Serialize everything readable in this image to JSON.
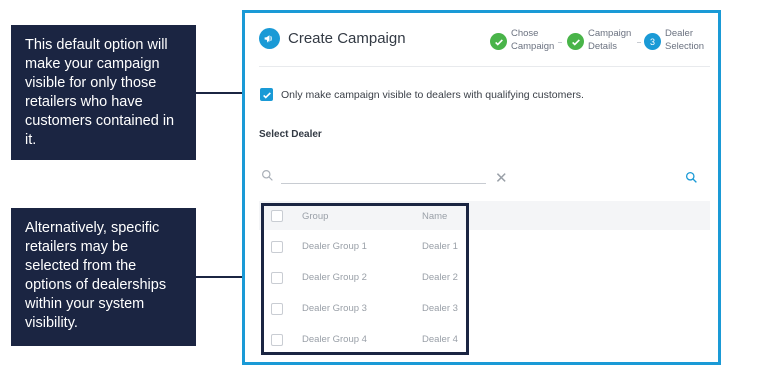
{
  "annotations": {
    "default_option": "This default option will make your campaign visible for only those retailers who have customers contained in it.",
    "specific_selection": "Alternatively, specific retailers may be selected from the options of dealerships within your system visibility."
  },
  "modal": {
    "title": "Create Campaign",
    "steps": [
      {
        "label_line1": "Chose",
        "label_line2": "Campaign",
        "state": "complete"
      },
      {
        "label_line1": "Campaign",
        "label_line2": "Details",
        "state": "complete"
      },
      {
        "number": "3",
        "label_line1": "Dealer",
        "label_line2": "Selection",
        "state": "active"
      }
    ],
    "visibility_option": {
      "checked": true,
      "label": "Only make campaign visible to dealers with qualifying customers."
    },
    "select_dealer_label": "Select Dealer",
    "search": {
      "value": ""
    },
    "table": {
      "headers": {
        "group": "Group",
        "name": "Name"
      },
      "rows": [
        {
          "group": "Dealer Group 1",
          "name": "Dealer 1"
        },
        {
          "group": "Dealer Group 2",
          "name": "Dealer 2"
        },
        {
          "group": "Dealer Group 3",
          "name": "Dealer 3"
        },
        {
          "group": "Dealer Group 4",
          "name": "Dealer 4"
        }
      ]
    }
  },
  "colors": {
    "accent": "#1a9ad6",
    "step_complete": "#49b449",
    "callout_bg": "#1b2542"
  },
  "icons": {
    "campaign": "megaphone-icon",
    "step_complete": "check-icon",
    "search": "search-icon",
    "clear": "close-icon"
  }
}
